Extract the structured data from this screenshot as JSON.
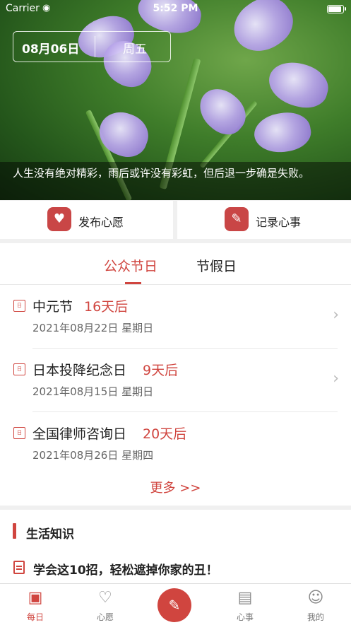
{
  "status_bar": {
    "carrier": "Carrier",
    "time": "5:52 PM"
  },
  "hero": {
    "date": "08月06日",
    "weekday": "周五",
    "quote": "人生没有绝对精彩，雨后或许没有彩虹，但后退一步确是失败。"
  },
  "actions": [
    {
      "label": "发布心愿",
      "icon": "wish-icon"
    },
    {
      "label": "记录心事",
      "icon": "note-edit-icon"
    }
  ],
  "tabs": [
    {
      "label": "公众节日",
      "active": true
    },
    {
      "label": "节假日",
      "active": false
    }
  ],
  "holidays": [
    {
      "name": "中元节",
      "countdown": "16天后",
      "date": "2021年08月22日 星期日"
    },
    {
      "name": "日本投降纪念日",
      "countdown": "9天后",
      "date": "2021年08月15日 星期日"
    },
    {
      "name": "全国律师咨询日",
      "countdown": "20天后",
      "date": "2021年08月26日 星期四"
    }
  ],
  "more_label": "更多 >>",
  "knowledge": {
    "title": "生活知识",
    "items": [
      "学会这10招，轻松遮掉你家的丑！"
    ]
  },
  "tabbar": [
    {
      "label": "每日",
      "icon": "calendar-icon",
      "active": true
    },
    {
      "label": "心愿",
      "icon": "heart-icon",
      "active": false
    },
    {
      "label": "",
      "icon": "write-icon",
      "active": false
    },
    {
      "label": "心事",
      "icon": "clipboard-icon",
      "active": false
    },
    {
      "label": "我的",
      "icon": "person-icon",
      "active": false
    }
  ],
  "colors": {
    "accent": "#d0453f"
  }
}
